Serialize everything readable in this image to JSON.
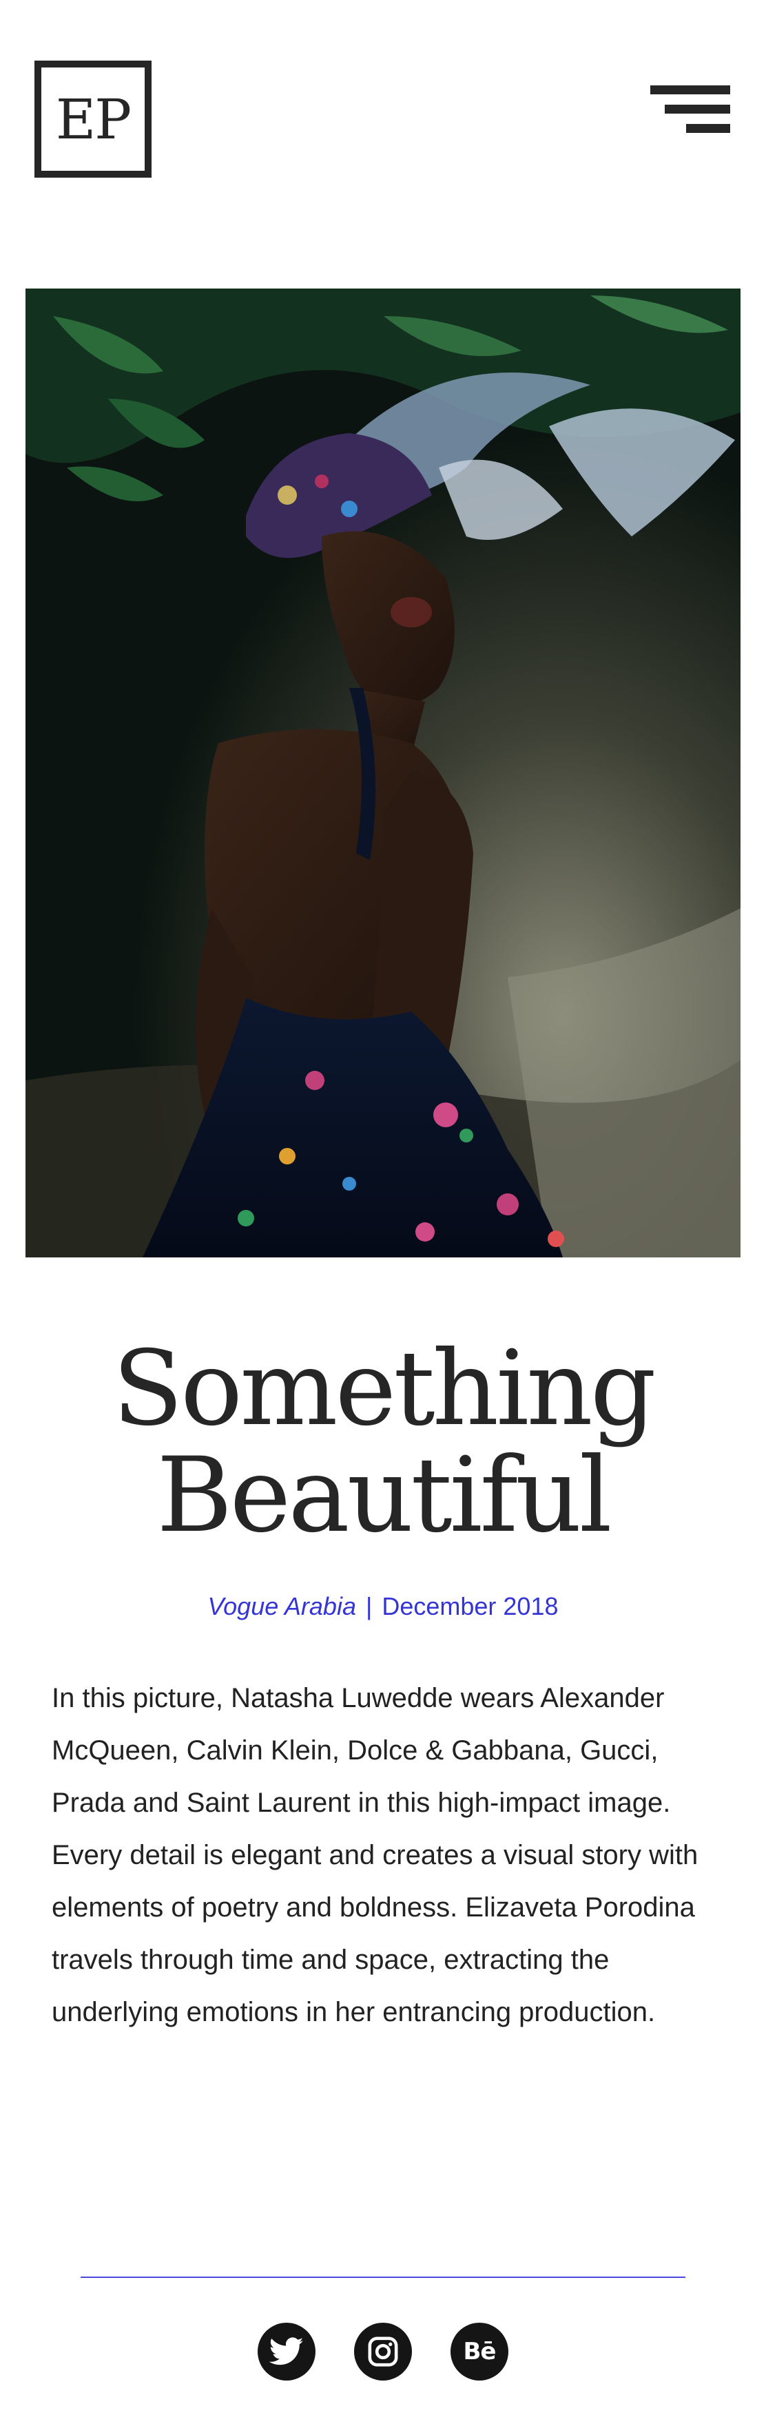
{
  "header": {
    "logo_text": "EP",
    "menu_icon": "hamburger-menu-icon"
  },
  "hero": {
    "image_description_icon": "photo"
  },
  "article": {
    "title_line1": "Something",
    "title_line2": "Beautiful",
    "publication": "Vogue Arabia",
    "separator": "|",
    "date": "December 2018",
    "description": "In this picture, Natasha Luwedde wears Alexander McQueen, Calvin Klein, Dolce & Gabbana, Gucci, Prada and Saint Laurent in this high-impact image. Every detail is elegant and creates a visual story with elements of poetry and boldness. Elizaveta Porodina travels through time and space, extracting the underlying emotions in her entrancing production."
  },
  "footer": {
    "social": [
      {
        "icon": "twitter-icon"
      },
      {
        "icon": "instagram-icon"
      },
      {
        "icon": "behance-icon",
        "glyph": "Bē"
      }
    ]
  },
  "colors": {
    "accent": "#3535d6",
    "text": "#262626",
    "background": "#ffffff"
  }
}
